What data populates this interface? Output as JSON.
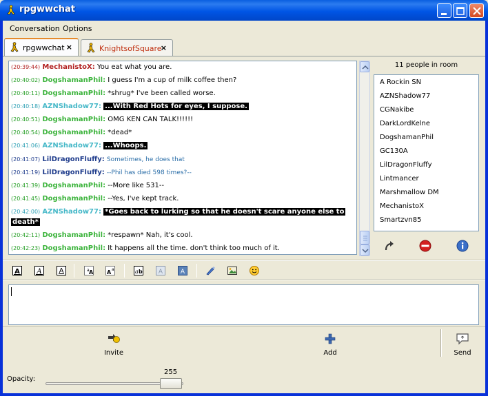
{
  "window": {
    "title": "rpgwwchat",
    "app_icon": "aim-running-man-icon",
    "controls": [
      "minimize",
      "maximize",
      "close"
    ]
  },
  "menu": {
    "conversation": "Conversation",
    "options": "Options"
  },
  "tabs": [
    {
      "label": "rpgwwchat",
      "close": "×",
      "active": true
    },
    {
      "label": "KnightsofSquare",
      "close": "×",
      "active": false,
      "color": "#c03010"
    }
  ],
  "chat": {
    "messages": [
      {
        "time": "(20:39:44)",
        "nick": "MechanistoX:",
        "text": "You eat what you are.",
        "color": "red"
      },
      {
        "time": "(20:40:02)",
        "nick": "DogshamanPhil:",
        "text": "I guess I'm a cup of milk coffee then?",
        "color": "green"
      },
      {
        "time": "(20:40:11)",
        "nick": "DogshamanPhil:",
        "text": "*shrug*  I've been called worse.",
        "color": "green"
      },
      {
        "time": "(20:40:18)",
        "nick": "AZNShadow77:",
        "text": "...With Red Hots for eyes, I suppose.",
        "color": "cyan",
        "highlight": true
      },
      {
        "time": "(20:40:51)",
        "nick": "DogshamanPhil:",
        "text": "OMG KEN CAN TALK!!!!!!",
        "color": "green"
      },
      {
        "time": "(20:40:54)",
        "nick": "DogshamanPhil:",
        "text": "*dead*",
        "color": "green"
      },
      {
        "time": "(20:41:06)",
        "nick": "AZNShadow77:",
        "text": "...Whoops.",
        "color": "cyan",
        "highlight": true
      },
      {
        "time": "(20:41:07)",
        "nick": "LilDragonFluffy:",
        "text": "Sometimes, he does that",
        "color": "blue"
      },
      {
        "time": "(20:41:19)",
        "nick": "LilDragonFluffy:",
        "text": "--Phil has died 598 times?--",
        "color": "blue"
      },
      {
        "time": "(20:41:39)",
        "nick": "DogshamanPhil:",
        "text": "--More like 531--",
        "color": "green"
      },
      {
        "time": "(20:41:45)",
        "nick": "DogshamanPhil:",
        "text": "--Yes, I've kept track.",
        "color": "green"
      },
      {
        "time": "(20:42:00)",
        "nick": "AZNShadow77:",
        "text": "*Goes back to lurking so that he doesn't scare anyone else to",
        "text2": "death*",
        "color": "cyan",
        "highlight": true
      },
      {
        "time": "(20:42:11)",
        "nick": "DogshamanPhil:",
        "text": "*respawn* Nah, it's cool.",
        "color": "green"
      },
      {
        "time": "(20:42:23)",
        "nick": "DogshamanPhil:",
        "text": "It happens all the time.  don't think too much of it.",
        "color": "green"
      }
    ]
  },
  "people": {
    "header": "11 people in room",
    "list": [
      "A Rockin SN",
      "AZNShadow77",
      "CGNakibe",
      "DarkLordKelne",
      "DogshamanPhil",
      "GC130A",
      "LilDragonFluffy",
      "Lintmancer",
      "Marshmallow DM",
      "MechanistoX",
      "Smartzvn85"
    ]
  },
  "format_toolbar": [
    "bold",
    "italic",
    "underline",
    "text-larger",
    "text-smaller",
    "font-face",
    "fg-color",
    "bg-color",
    "link",
    "image",
    "smiley"
  ],
  "buttons": {
    "invite": "Invite",
    "add": "Add",
    "send": "Send"
  },
  "opacity": {
    "label": "Opacity:",
    "value": "255"
  }
}
